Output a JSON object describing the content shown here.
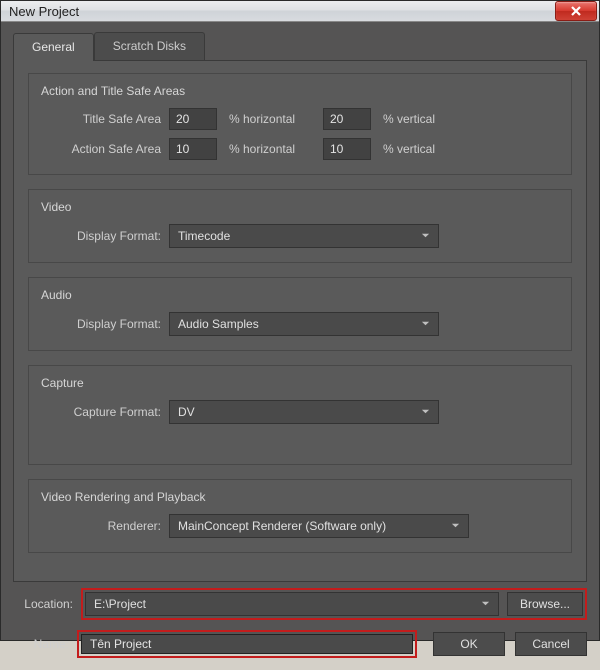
{
  "window": {
    "title": "New Project"
  },
  "tabs": {
    "general": "General",
    "scratch": "Scratch Disks"
  },
  "safeAreas": {
    "title": "Action and Title Safe Areas",
    "titleSafeLabel": "Title Safe Area",
    "actionSafeLabel": "Action Safe Area",
    "titleH": "20",
    "titleV": "20",
    "actionH": "10",
    "actionV": "10",
    "pctH": "% horizontal",
    "pctV": "% vertical"
  },
  "video": {
    "title": "Video",
    "label": "Display Format:",
    "value": "Timecode"
  },
  "audio": {
    "title": "Audio",
    "label": "Display Format:",
    "value": "Audio Samples"
  },
  "capture": {
    "title": "Capture",
    "label": "Capture Format:",
    "value": "DV"
  },
  "render": {
    "title": "Video Rendering and Playback",
    "label": "Renderer:",
    "value": "MainConcept Renderer (Software only)"
  },
  "location": {
    "label": "Location:",
    "value": "E:\\Project",
    "browse": "Browse..."
  },
  "name": {
    "label": "Name:",
    "value": "Tên Project"
  },
  "buttons": {
    "ok": "OK",
    "cancel": "Cancel"
  }
}
